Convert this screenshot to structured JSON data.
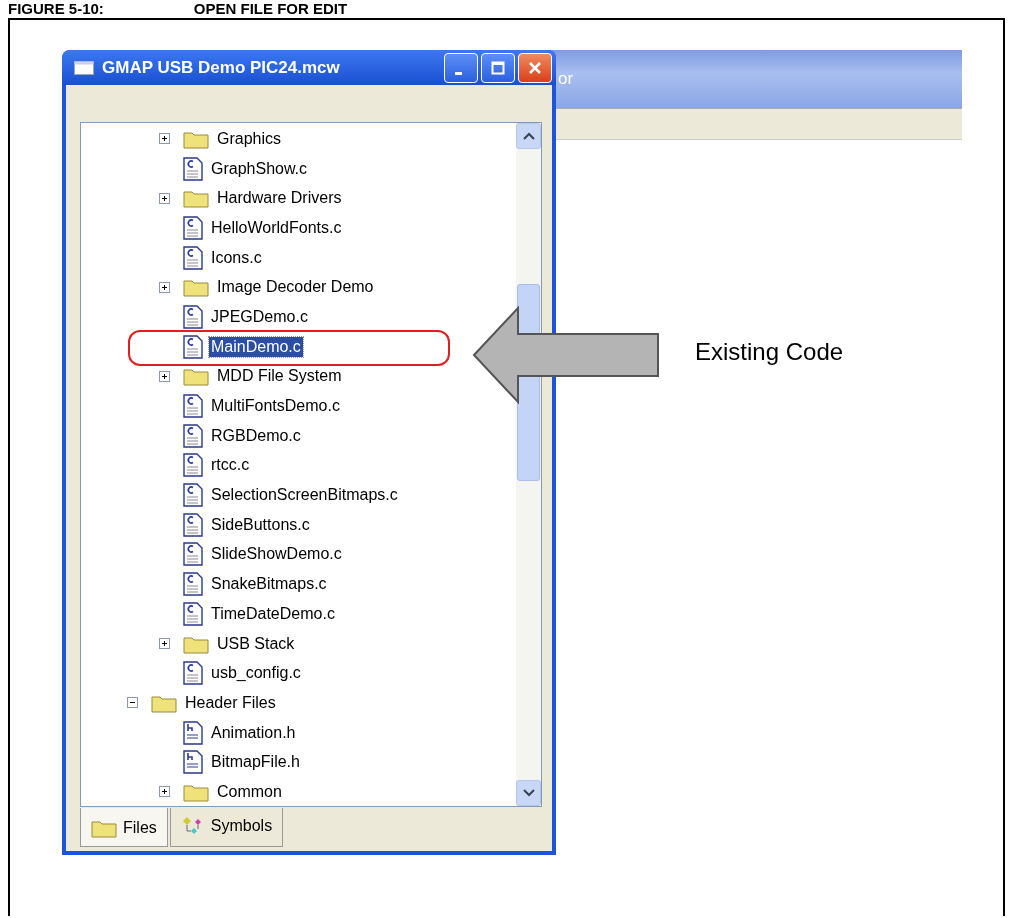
{
  "caption": {
    "number": "FIGURE 5-10:",
    "title": "OPEN FILE FOR EDIT"
  },
  "background_window": {
    "title": "or"
  },
  "window": {
    "title": "GMAP USB Demo PIC24.mcw"
  },
  "tree": [
    {
      "kind": "group",
      "children": [
        {
          "label": "Graphics",
          "kind": "folder",
          "expanded": false,
          "selected": false
        },
        {
          "label": "GraphShow.c",
          "kind": "c-file",
          "selected": false
        },
        {
          "label": "Hardware Drivers",
          "kind": "folder",
          "expanded": false,
          "selected": false
        },
        {
          "label": "HelloWorldFonts.c",
          "kind": "c-file",
          "selected": false
        },
        {
          "label": "Icons.c",
          "kind": "c-file",
          "selected": false
        },
        {
          "label": "Image Decoder Demo",
          "kind": "folder",
          "expanded": false,
          "selected": false
        },
        {
          "label": "JPEGDemo.c",
          "kind": "c-file",
          "selected": false
        },
        {
          "label": "MainDemo.c",
          "kind": "c-file",
          "selected": true
        },
        {
          "label": "MDD File System",
          "kind": "folder",
          "expanded": false,
          "selected": false
        },
        {
          "label": "MultiFontsDemo.c",
          "kind": "c-file",
          "selected": false
        },
        {
          "label": "RGBDemo.c",
          "kind": "c-file",
          "selected": false
        },
        {
          "label": "rtcc.c",
          "kind": "c-file",
          "selected": false
        },
        {
          "label": "SelectionScreenBitmaps.c",
          "kind": "c-file",
          "selected": false
        },
        {
          "label": "SideButtons.c",
          "kind": "c-file",
          "selected": false
        },
        {
          "label": "SlideShowDemo.c",
          "kind": "c-file",
          "selected": false
        },
        {
          "label": "SnakeBitmaps.c",
          "kind": "c-file",
          "selected": false
        },
        {
          "label": "TimeDateDemo.c",
          "kind": "c-file",
          "selected": false
        },
        {
          "label": "USB Stack",
          "kind": "folder",
          "expanded": false,
          "selected": false
        },
        {
          "label": "usb_config.c",
          "kind": "c-file",
          "selected": false
        }
      ]
    },
    {
      "label": "Header Files",
      "kind": "folder",
      "expanded": true,
      "selected": false,
      "children": [
        {
          "label": "Animation.h",
          "kind": "h-file",
          "selected": false
        },
        {
          "label": "BitmapFile.h",
          "kind": "h-file",
          "selected": false
        },
        {
          "label": "Common",
          "kind": "folder",
          "expanded": false,
          "selected": false
        }
      ]
    }
  ],
  "tabs": [
    {
      "label": "Files",
      "kind": "files",
      "selected": true
    },
    {
      "label": "Symbols",
      "kind": "symbols",
      "selected": false
    }
  ],
  "annotation": {
    "text": "Existing Code"
  }
}
